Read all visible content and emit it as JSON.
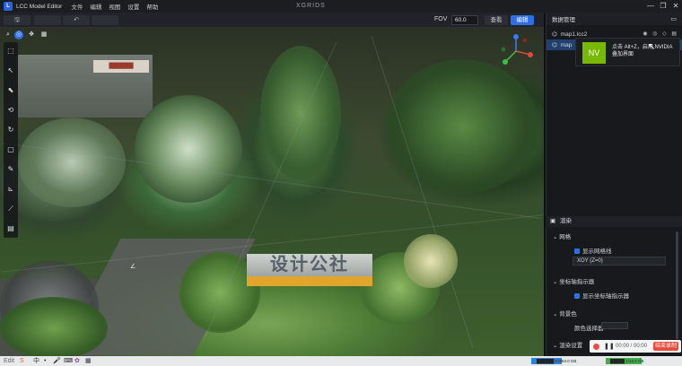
{
  "titlebar": {
    "app_title": "LCC Model Editor",
    "menus": [
      "文件",
      "编辑",
      "视图",
      "设置",
      "帮助"
    ],
    "brand": "XGRIDS",
    "minimize": "—",
    "maximize": "❐",
    "close": "✕"
  },
  "toolbar": {
    "fov_label": "FOV",
    "fov_value": "60.0",
    "view_button": "查看",
    "edit_button": "编辑"
  },
  "scene": {
    "banner_text": "▇▇▇▇▇",
    "sign_text": "设计公社",
    "road_marker": "∠"
  },
  "data_panel": {
    "title": "数据管理",
    "items": [
      {
        "name": "map1.lcc2",
        "selected": false
      },
      {
        "name": "map",
        "selected": true
      }
    ],
    "actions": "◉ ◎ ◇ ▤"
  },
  "toast": {
    "logo": "NV",
    "text": "点击 Alt+Z，启用 NVIDIA 叠加界面"
  },
  "render_panel": {
    "title": "渲染",
    "grid_section": "网格",
    "show_grid_label": "显示网格线",
    "grid_plane": "XOY (Z=0)",
    "axis_section": "坐标轴指示器",
    "show_axis_label": "显示坐标轴指示器",
    "bg_section": "背景色",
    "color_picker_label": "颜色选择器",
    "next_section": "渲染设置"
  },
  "recording": {
    "time": "00:00 / 00:00",
    "end_label": "结束录制"
  },
  "taskbar": {
    "left_label": "Edit",
    "ime": "中",
    "status_left": "██████ 0.0/63.0 GB",
    "status_right": "█████ 1/12.0 GB"
  },
  "colors": {
    "accent": "#2e6fe8",
    "record_red": "#e94b3c",
    "nvidia_green": "#76b900"
  }
}
